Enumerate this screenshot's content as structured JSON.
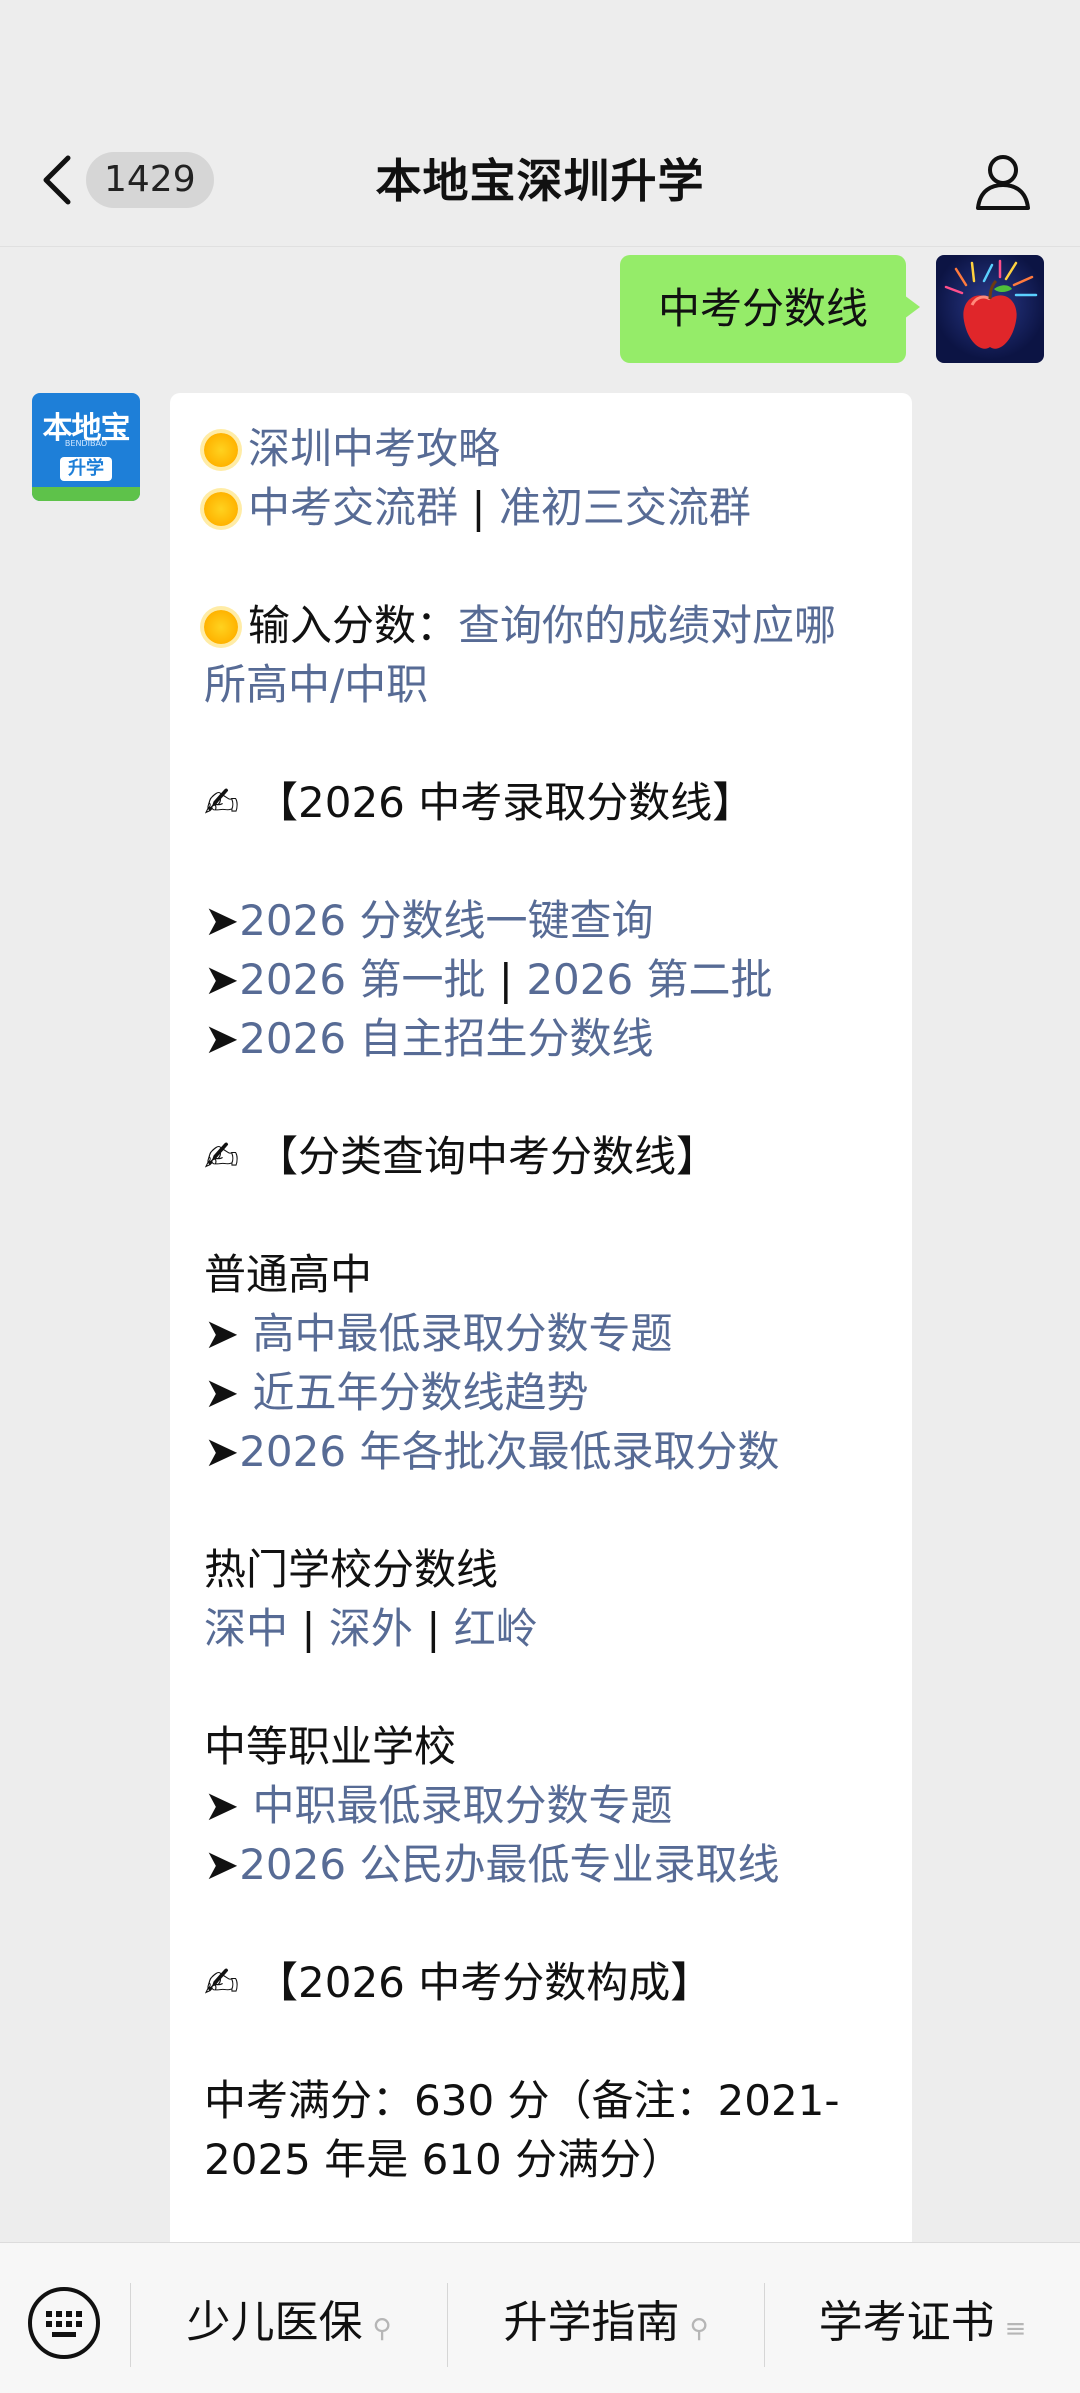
{
  "header": {
    "unread_count": "1429",
    "title": "本地宝深圳升学"
  },
  "user_message": {
    "text": "中考分数线"
  },
  "bot_avatar": {
    "logo_text": "本地宝",
    "logo_sub": "BENDIBAO",
    "logo_tag": "升学"
  },
  "bot_message": {
    "strategy_link": "深圳中考攻略",
    "group_link_1": "中考交流群",
    "separator": " | ",
    "group_link_2": "准初三交流群",
    "input_prefix": "输入分数：",
    "input_link": "查询你的成绩对应哪所高中/中职",
    "section1_title": "【2026 中考录取分数线】",
    "s1_item1": "2026 分数线一键查询",
    "s1_item2a": "2026 第一批",
    "s1_item2b": "2026 第二批",
    "s1_item3": "2026 自主招生分数线",
    "section2_title": "【分类查询中考分数线】",
    "general_hs_title": "普通高中",
    "gh_item1": "高中最低录取分数专题",
    "gh_item2": "近五年分数线趋势",
    "gh_item3": "2026 年各批次最低录取分数",
    "hot_school_title": "热门学校分数线",
    "hot_1": "深中",
    "hot_2": "深外",
    "hot_3": "红岭",
    "vocational_title": "中等职业学校",
    "voc_item1": "中职最低录取分数专题",
    "voc_item2": "2026 公民办最低专业录取线",
    "section3_title": "【2026 中考分数构成】",
    "full_score_text": "中考满分：630 分（备注：2021-2025 年是 610 分满分）",
    "arrow": "➤",
    "arrow_spaced": "➤ "
  },
  "bottom_menu": {
    "items": [
      "少儿医保",
      "升学指南",
      "学考证书"
    ]
  },
  "colors": {
    "background": "#ededed",
    "user_bubble": "#95ec69",
    "link": "#576b95",
    "bot_brand": "#1e7fd8"
  },
  "icons": {
    "back": "chevron-left-icon",
    "profile": "person-icon",
    "keyboard": "keyboard-icon",
    "menu_link": "link-icon",
    "menu_list": "list-icon"
  }
}
